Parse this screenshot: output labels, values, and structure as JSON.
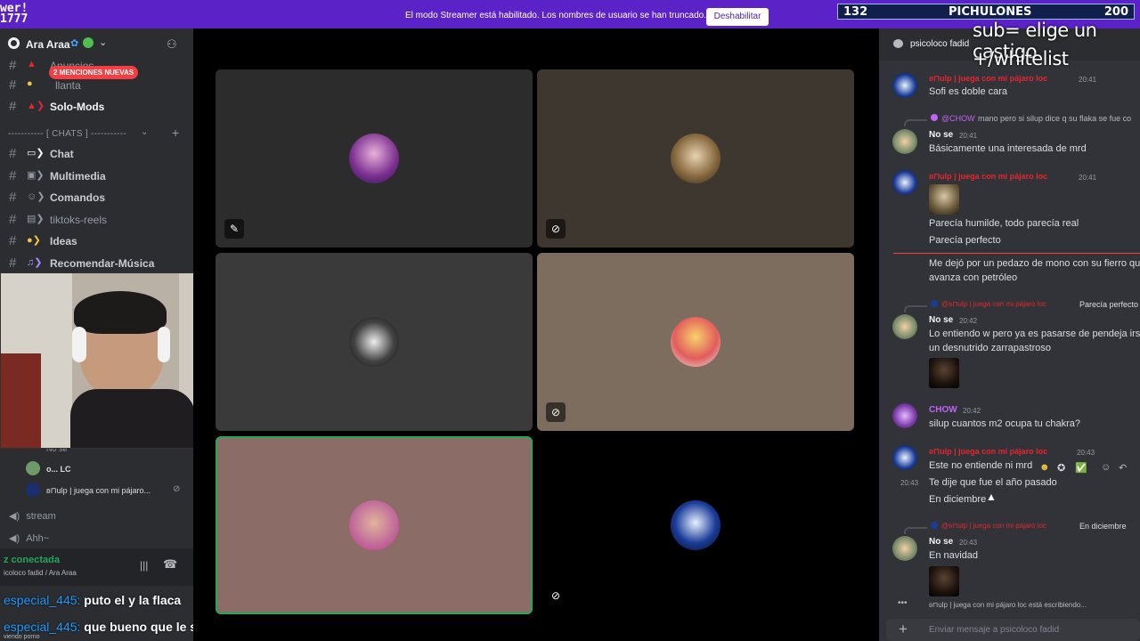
{
  "topbar": {
    "message": "El modo Streamer está habilitado. Los nombres de usuario se han truncado.",
    "button": "Deshabilitar",
    "overlay_left": "wer!\n1777"
  },
  "counter": {
    "left": "132",
    "center": "PICHULONES",
    "right": "200"
  },
  "server": {
    "name": "Ara Araa"
  },
  "sidebar": {
    "mentions_badge": "2 MENCIONES NUEVAS",
    "channels_top": [
      {
        "label": "Anuncios"
      },
      {
        "label": "llanta"
      },
      {
        "label": "Solo-Mods"
      }
    ],
    "category": "----------- [ CHATS ] -----------",
    "channels": [
      {
        "label": "Chat"
      },
      {
        "label": "Multimedia"
      },
      {
        "label": "Comandos"
      },
      {
        "label": "tiktoks-reels"
      },
      {
        "label": "Ideas"
      },
      {
        "label": "Recomendar-Música"
      }
    ],
    "voice_users": [
      {
        "name": "No se"
      },
      {
        "name": "o... LC"
      },
      {
        "name": "ʚ⊓ulp | juega con mi pájaro..."
      }
    ],
    "voice_channels": [
      {
        "label": "stream"
      },
      {
        "label": "Ahh~"
      }
    ]
  },
  "voice_panel": {
    "status": "z conectada",
    "sub": "icoloco fadid / Ara Araa"
  },
  "stream_chat": [
    {
      "user": "especial_445:",
      "text": "puto el y la flaca"
    },
    {
      "user": "especial_445:",
      "text": "que bueno que le sacaron los cachos mano"
    }
  ],
  "viewing": "viendo porno",
  "chat": {
    "title": "psicoloco fadid",
    "overlay_line1": "sub= elige un castigo",
    "overlay_line2": "+/whitelist",
    "messages": [
      {
        "author": "ʚ⊓ulp | juega con mi pájaro loc",
        "time": "20:41",
        "text": "Sofi es doble cara"
      },
      {
        "reply_user": "@CHOW",
        "reply_text": "mano pero si silup dice q su flaka se fue co"
      },
      {
        "author": "No se",
        "time": "20:41",
        "text": "Básicamente una interesada de mrd"
      },
      {
        "author": "ʚ⊓ulp | juega con mi pájaro loc",
        "time": "20:41",
        "lines": [
          "Parecía humilde, todo parecía real",
          "Parecía perfecto"
        ]
      },
      {
        "text_lines": [
          "Me dejó por un pedazo de mono con su fierro que",
          "avanza con petróleo"
        ]
      },
      {
        "reply_user": "@ʚ⊓ulp | juega con mi pájaro loc",
        "reply_text": "Parecía perfecto"
      },
      {
        "author": "No se",
        "time": "20:42",
        "lines": [
          "Lo entiendo w pero ya es pasarse de pendeja irse",
          "un desnutrido zarrapastroso"
        ]
      },
      {
        "author": "CHOW",
        "time": "20:42",
        "text": "silup cuantos m2 ocupa tu chakra?"
      },
      {
        "author": "ʚ⊓ulp | juega con mi pájaro loc",
        "time": "20:43",
        "lines": [
          "Este no entiende ni mrd",
          "Te dije que fue el año pasado",
          "En diciembre"
        ],
        "side_time": "20:43"
      },
      {
        "reply_user": "@ʚ⊓ulp | juega con mi pájaro loc",
        "reply_text": "En diciembre"
      },
      {
        "author": "No se",
        "time": "20:43",
        "text": "En navidad"
      }
    ],
    "typing": "ʚ⊓ulp | juega con mi pájaro loc está escribiendo...",
    "input_placeholder": "Enviar mensaje a psicoloco fadid"
  },
  "colors": {
    "accent": "#5b22c8",
    "red_name": "#e5262f",
    "chow": "#c163f5",
    "green": "#23a55a"
  }
}
